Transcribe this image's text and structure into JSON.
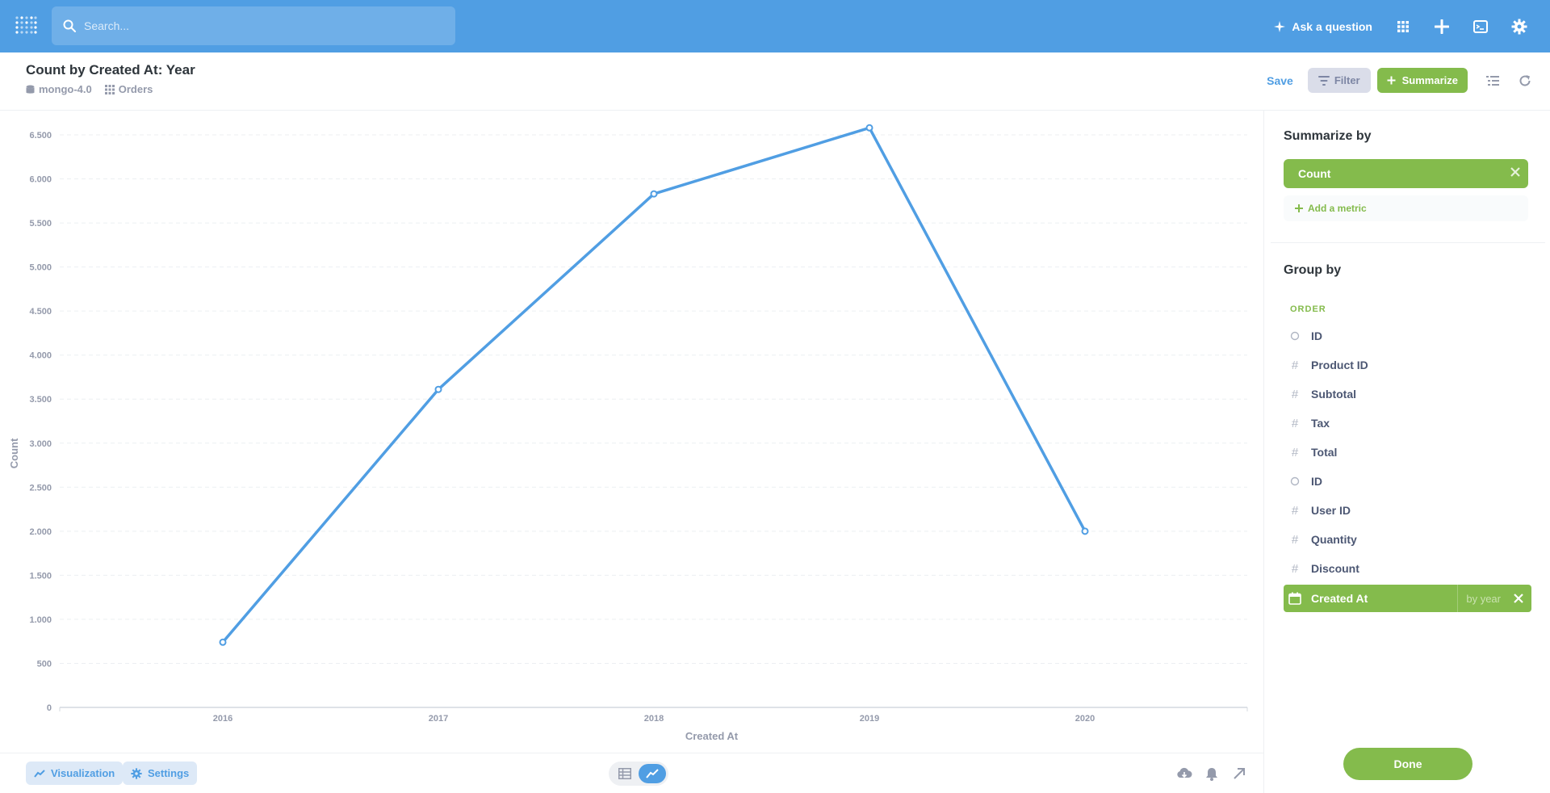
{
  "nav": {
    "search_placeholder": "Search...",
    "ask_label": "Ask a question",
    "icons": [
      "grid-icon",
      "plus-icon",
      "terminal-icon",
      "gear-icon"
    ],
    "color": "#509ee3"
  },
  "header": {
    "title": "Count by Created At: Year",
    "database": "mongo-4.0",
    "table": "Orders",
    "save_label": "Save",
    "filter_label": "Filter",
    "summarize_label": "Summarize"
  },
  "chart_data": {
    "type": "line",
    "x": [
      "2016",
      "2017",
      "2018",
      "2019",
      "2020"
    ],
    "series": [
      {
        "values": [
          740,
          3610,
          5830,
          6580,
          2000
        ]
      }
    ],
    "xlabel": "Created At",
    "ylabel": "Count",
    "ylim": [
      0,
      6500
    ],
    "yticks": [
      "0",
      "500",
      "1.000",
      "1.500",
      "2.000",
      "2.500",
      "3.000",
      "3.500",
      "4.000",
      "4.500",
      "5.000",
      "5.500",
      "6.000",
      "6.500"
    ],
    "grid": true,
    "line_color": "#509ee3"
  },
  "bottom": {
    "visualization_label": "Visualization",
    "settings_label": "Settings"
  },
  "sidebar": {
    "summarize_title": "Summarize by",
    "metric_label": "Count",
    "add_metric_label": "Add a metric",
    "group_title": "Group by",
    "section_label": "ORDER",
    "dimensions": [
      {
        "label": "ID",
        "icon": "circle"
      },
      {
        "label": "Product ID",
        "icon": "#"
      },
      {
        "label": "Subtotal",
        "icon": "#"
      },
      {
        "label": "Tax",
        "icon": "#"
      },
      {
        "label": "Total",
        "icon": "#"
      },
      {
        "label": "ID",
        "icon": "circle"
      },
      {
        "label": "User ID",
        "icon": "#"
      },
      {
        "label": "Quantity",
        "icon": "#"
      },
      {
        "label": "Discount",
        "icon": "#"
      }
    ],
    "selected_dimension": {
      "label": "Created At",
      "granularity": "by year"
    },
    "done_label": "Done",
    "accent": "#84bb4c"
  }
}
